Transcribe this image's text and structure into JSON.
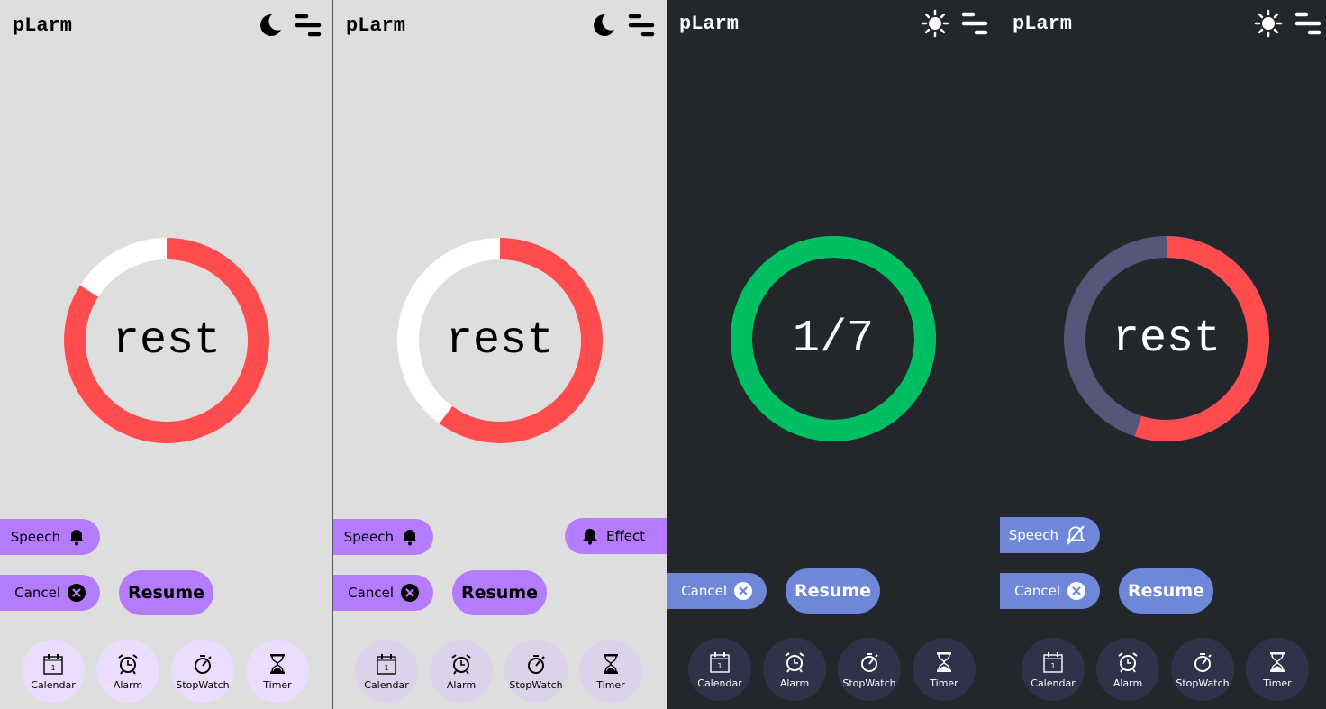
{
  "app_title": "pLarm",
  "nav_items": [
    {
      "label": "Calendar",
      "icon": "calendar-icon"
    },
    {
      "label": "Alarm",
      "icon": "alarm-clock-icon"
    },
    {
      "label": "StopWatch",
      "icon": "stopwatch-icon"
    },
    {
      "label": "Timer",
      "icon": "hourglass-icon"
    }
  ],
  "panels": [
    {
      "theme": "light",
      "theme_icon": "moon-icon",
      "ring_text": "rest",
      "progress": 0.84,
      "progress_color": "#ff4d4f",
      "track_color": "#ffffff",
      "speech_label": "Speech",
      "speech_icon": "bell-icon",
      "cancel_label": "Cancel",
      "resume_label": "Resume",
      "effect_label": ""
    },
    {
      "theme": "light",
      "theme_icon": "moon-icon",
      "ring_text": "rest",
      "progress": 0.6,
      "progress_color": "#ff4d4f",
      "track_color": "#ffffff",
      "speech_label": "Speech",
      "speech_icon": "bell-icon",
      "cancel_label": "Cancel",
      "resume_label": "Resume",
      "effect_label": "Effect"
    },
    {
      "theme": "dark",
      "theme_icon": "sun-icon",
      "ring_text": "1/7",
      "progress": 1.0,
      "progress_color": "#00bf63",
      "track_color": "#00bf63",
      "speech_label": "",
      "speech_icon": "",
      "cancel_label": "Cancel",
      "resume_label": "Resume",
      "effect_label": ""
    },
    {
      "theme": "dark",
      "theme_icon": "sun-icon",
      "ring_text": "rest",
      "progress": 0.55,
      "progress_color": "#ff4d4f",
      "track_color": "#56567a",
      "speech_label": "Speech",
      "speech_icon": "bell-slash-icon",
      "cancel_label": "Cancel",
      "resume_label": "Resume",
      "effect_label": ""
    }
  ],
  "colors": {
    "light_bg": "#dedede",
    "dark_bg": "#23272b",
    "light_button": "#b57bff",
    "dark_button": "#6e87d8",
    "light_nav": "#ecdcff",
    "light_nav_dim": "#dcd3ea",
    "dark_nav": "#31324a"
  }
}
